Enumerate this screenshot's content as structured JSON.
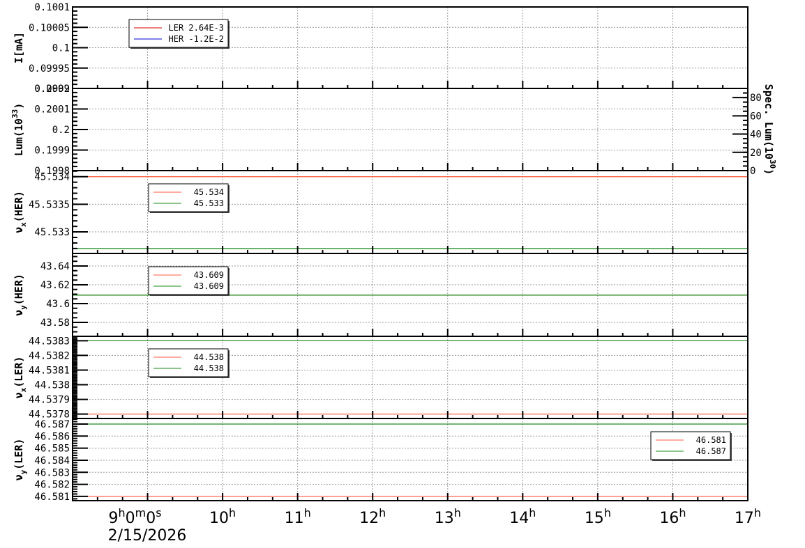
{
  "chart_data": [
    {
      "type": "line",
      "ylabel": {
        "main": "I[mA]",
        "sub": "",
        "sup": "",
        "rest": ""
      },
      "ylim": [
        0.0999,
        0.1001
      ],
      "yticks": [
        0.1001,
        0.10005,
        0.1,
        0.09995,
        0.0999
      ],
      "ytick_labels": [
        "0.1001",
        "0.10005",
        "0.1",
        "0.09995",
        "0.0999"
      ],
      "minor_step": 1e-05,
      "legend": {
        "placement": "top-left",
        "entries": [
          {
            "label": "LER  2.64E-3",
            "color": "#e00000"
          },
          {
            "label": "HER  -1.2E-2",
            "color": "#0000d0"
          }
        ]
      },
      "series": []
    },
    {
      "type": "line",
      "ylabel": {
        "main": "Lum(10",
        "sup": "33",
        "sub": "",
        "rest": ")"
      },
      "ylim": [
        0.1998,
        0.2002
      ],
      "yticks": [
        0.2002,
        0.2001,
        0.2,
        0.1999,
        0.1998
      ],
      "ytick_labels": [
        "0.2002",
        "0.2001",
        "0.2",
        "0.1999",
        "0.1998"
      ],
      "minor_step": 2e-05,
      "right_axis": {
        "label_main": "Spec. Lum(10",
        "label_sup": "30",
        "label_rest": ")",
        "ylim": [
          0,
          90
        ],
        "yticks": [
          0,
          20,
          40,
          60,
          80
        ],
        "ytick_labels": [
          "0",
          "20",
          "40",
          "60",
          "80"
        ],
        "minor_step": 5
      },
      "series": []
    },
    {
      "type": "line",
      "ylabel": {
        "main": "ν",
        "sub": "x",
        "sup": "",
        "rest": "(HER)"
      },
      "ylim": [
        45.53261,
        45.53411
      ],
      "yticks": [
        45.534,
        45.5335,
        45.533
      ],
      "ytick_labels": [
        "45.534",
        "45.5335",
        "45.533"
      ],
      "minor_step": 0.0001,
      "legend": {
        "placement": "top-left",
        "entries": [
          {
            "label": "45.534",
            "color": "#ff5a3c"
          },
          {
            "label": "45.533",
            "color": "#1a8a1a"
          }
        ]
      },
      "series": [
        {
          "color": "#ff5a3c",
          "value": 45.534
        },
        {
          "color": "#1a8a1a",
          "value": 45.5327
        }
      ]
    },
    {
      "type": "line",
      "ylabel": {
        "main": "ν",
        "sub": "y",
        "sup": "",
        "rest": "(HER)"
      },
      "ylim": [
        43.5652,
        43.6533
      ],
      "yticks": [
        43.64,
        43.62,
        43.6,
        43.58
      ],
      "ytick_labels": [
        "43.64",
        "43.62",
        "43.6",
        "43.58"
      ],
      "minor_step": 0.005,
      "legend": {
        "placement": "top-left",
        "entries": [
          {
            "label": "43.609",
            "color": "#ff5a3c"
          },
          {
            "label": "43.609",
            "color": "#1a8a1a"
          }
        ]
      },
      "series": [
        {
          "color": "#ff5a3c",
          "value": 43.609
        },
        {
          "color": "#1a8a1a",
          "value": 43.609
        }
      ]
    },
    {
      "type": "line",
      "ylabel": {
        "main": "ν",
        "sub": "x",
        "sup": "",
        "rest": "(LER)"
      },
      "ylim": [
        44.53777,
        44.53833
      ],
      "yticks": [
        44.5383,
        44.5382,
        44.5381,
        44.538,
        44.5379,
        44.5378
      ],
      "ytick_labels": [
        "44.5383",
        "44.5382",
        "44.5381",
        "44.538",
        "44.5379",
        "44.5378"
      ],
      "minor_step": 1e-05,
      "legend": {
        "placement": "top-left",
        "entries": [
          {
            "label": "44.538",
            "color": "#ff5a3c"
          },
          {
            "label": "44.538",
            "color": "#1a8a1a"
          }
        ]
      },
      "series": [
        {
          "color": "#ff5a3c",
          "value": 44.5378
        },
        {
          "color": "#1a8a1a",
          "value": 44.5383
        }
      ]
    },
    {
      "type": "line",
      "ylabel": {
        "main": "ν",
        "sub": "y",
        "sup": "",
        "rest": "(LER)"
      },
      "ylim": [
        46.58065,
        46.58746
      ],
      "yticks": [
        46.587,
        46.586,
        46.585,
        46.584,
        46.583,
        46.582,
        46.581
      ],
      "ytick_labels": [
        "46.587",
        "46.586",
        "46.585",
        "46.584",
        "46.583",
        "46.582",
        "46.581"
      ],
      "minor_step": 0.0002,
      "legend": {
        "placement": "top-right",
        "entries": [
          {
            "label": "46.581",
            "color": "#ff5a3c"
          },
          {
            "label": "46.587",
            "color": "#1a8a1a"
          }
        ]
      },
      "series": [
        {
          "color": "#ff5a3c",
          "value": 46.581
        },
        {
          "color": "#1a8a1a",
          "value": 46.587
        }
      ]
    }
  ],
  "x_axis": {
    "xlim_hours": [
      8,
      17
    ],
    "ticks_hours": [
      9,
      10,
      11,
      12,
      13,
      14,
      15,
      16,
      17
    ],
    "tick_labels": [
      "9h0m0s",
      "10h",
      "11h",
      "12h",
      "13h",
      "14h",
      "15h",
      "16h",
      "17h"
    ],
    "minor_step_minutes": 20,
    "date_label": "2/15/2026"
  },
  "grid": true
}
